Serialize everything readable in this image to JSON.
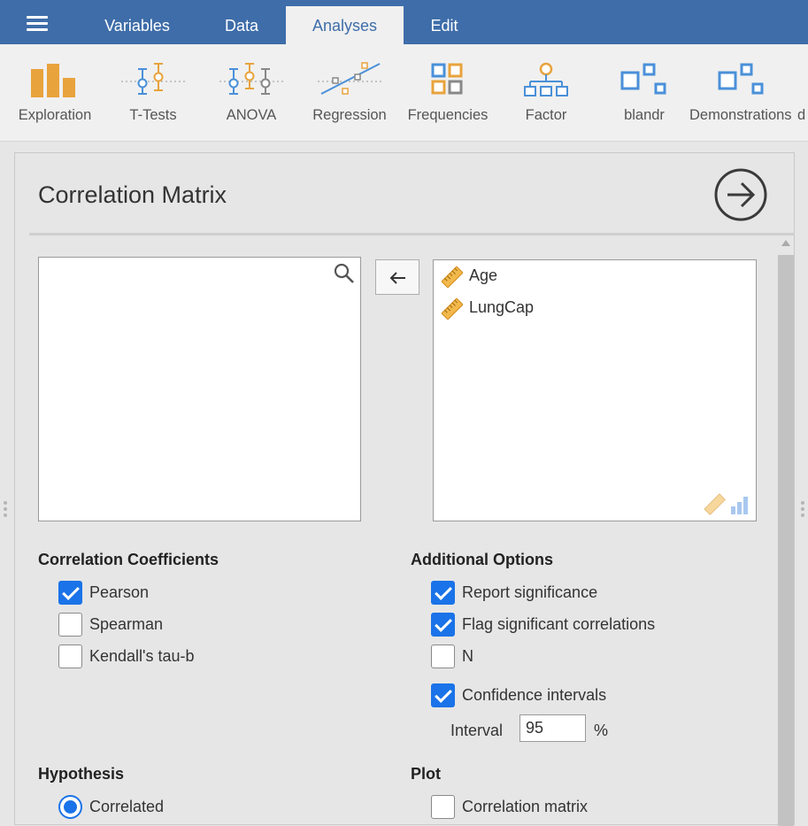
{
  "menubar": {
    "tabs": [
      {
        "label": "Variables"
      },
      {
        "label": "Data"
      },
      {
        "label": "Analyses",
        "active": true
      },
      {
        "label": "Edit"
      }
    ]
  },
  "ribbon": {
    "items": [
      {
        "label": "Exploration",
        "icon": "exploration-icon"
      },
      {
        "label": "T-Tests",
        "icon": "t-tests-icon"
      },
      {
        "label": "ANOVA",
        "icon": "anova-icon"
      },
      {
        "label": "Regression",
        "icon": "regression-icon"
      },
      {
        "label": "Frequencies",
        "icon": "frequencies-icon"
      },
      {
        "label": "Factor",
        "icon": "factor-icon"
      },
      {
        "label": "blandr",
        "icon": "module-icon"
      },
      {
        "label": "Demonstrations",
        "icon": "module-icon"
      },
      {
        "label": "d",
        "icon": ""
      }
    ]
  },
  "panel": {
    "title": "Correlation Matrix",
    "available_vars": [],
    "selected_vars": [
      {
        "name": "Age",
        "type": "continuous"
      },
      {
        "name": "LungCap",
        "type": "continuous"
      }
    ],
    "coefficients": {
      "heading": "Correlation Coefficients",
      "options": [
        {
          "label": "Pearson",
          "checked": true
        },
        {
          "label": "Spearman",
          "checked": false
        },
        {
          "label": "Kendall's tau-b",
          "checked": false
        }
      ]
    },
    "additional": {
      "heading": "Additional Options",
      "options": [
        {
          "label": "Report significance",
          "checked": true
        },
        {
          "label": "Flag significant correlations",
          "checked": true
        },
        {
          "label": "N",
          "checked": false
        },
        {
          "label": "Confidence intervals",
          "checked": true
        }
      ],
      "interval_label": "Interval",
      "interval_value": "95",
      "interval_unit": "%"
    },
    "hypothesis": {
      "heading": "Hypothesis",
      "selected": "Correlated"
    },
    "plot": {
      "heading": "Plot",
      "option": {
        "label": "Correlation matrix",
        "checked": false
      }
    }
  },
  "colors": {
    "menubar": "#3e6da9",
    "accent": "#1a73e8",
    "orange": "#e8a33d",
    "icon_blue": "#4a90d9"
  }
}
